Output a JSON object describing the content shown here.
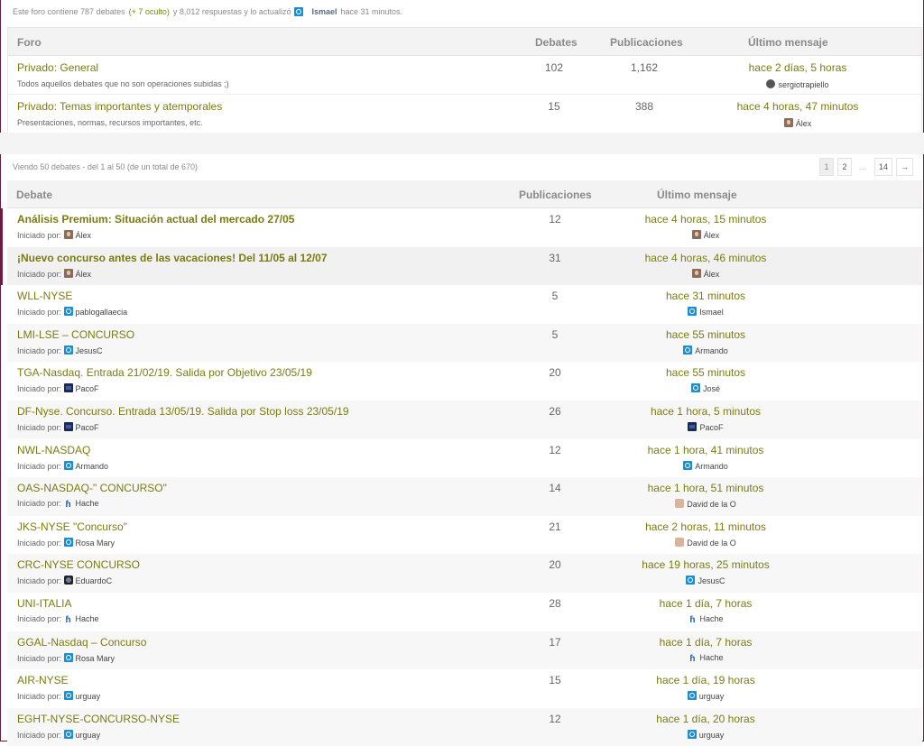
{
  "forum_info": {
    "prefix": "Este foro contiene 787 debates",
    "hidden": "(+ 7 oculto)",
    "middle": "y 8,012 respuestas y lo actualizó",
    "user": "Ismael",
    "time": "hace 31 minutos."
  },
  "forums_table": {
    "headers": {
      "forum": "Foro",
      "topics": "Debates",
      "posts": "Publicaciones",
      "last": "Último mensaje"
    },
    "rows": [
      {
        "title": "Privado: General",
        "desc": "Todos aquellos debates que no son operaciones subidas ;)",
        "topics": "102",
        "posts": "1,162",
        "last": "hace 2 días, 5 horas",
        "last_user": "sergiotrapiello",
        "icon": "avatar-round-icon"
      },
      {
        "title": "Privado: Temas importantes y atemporales",
        "desc": "Presentaciones, normas, recursos importantes, etc.",
        "topics": "15",
        "posts": "388",
        "last": "hace 4 horas, 47 minutos",
        "last_user": "Álex",
        "icon": "avatar-photo-icon"
      }
    ]
  },
  "viewing": "Viendo 50 debates - del 1 al 50 (de un total de 670)",
  "pagination": {
    "current": "1",
    "p2": "2",
    "dots": "…",
    "last": "14",
    "next": "→"
  },
  "topics_table": {
    "headers": {
      "topic": "Debate",
      "posts": "Publicaciones",
      "last": "Último mensaje"
    },
    "started_label": "Iniciado por:",
    "rows": [
      {
        "title": "Análisis Premium: Situación actual del mercado 27/05",
        "author": "Álex",
        "author_icon": "photo",
        "posts": "12",
        "last": "hace 4 horas, 15 minutos",
        "last_user": "Álex",
        "last_icon": "photo",
        "sticky": true
      },
      {
        "title": "¡Nuevo concurso antes de las vacaciones! Del 11/05 al 12/07",
        "author": "Álex",
        "author_icon": "photo",
        "posts": "31",
        "last": "hace 4 horas, 46 minutos",
        "last_user": "Álex",
        "last_icon": "photo",
        "sticky": true
      },
      {
        "title": "WLL-NYSE",
        "author": "pablogallaecia",
        "author_icon": "power",
        "posts": "5",
        "last": "hace 31 minutos",
        "last_user": "Ismael",
        "last_icon": "power"
      },
      {
        "title": "LMI-LSE – CONCURSO",
        "author": "JesusC",
        "author_icon": "power",
        "posts": "5",
        "last": "hace 55 minutos",
        "last_user": "Armando",
        "last_icon": "power"
      },
      {
        "title": "TGA-Nasdaq. Entrada 21/02/19. Salida por Objetivo 23/05/19",
        "author": "PacoF",
        "author_icon": "dark",
        "posts": "20",
        "last": "hace 55 minutos",
        "last_user": "José",
        "last_icon": "power"
      },
      {
        "title": "DF-Nyse. Concurso. Entrada 13/05/19. Salida por Stop loss 23/05/19",
        "author": "PacoF",
        "author_icon": "dark",
        "posts": "26",
        "last": "hace 1 hora, 5 minutos",
        "last_user": "PacoF",
        "last_icon": "dark"
      },
      {
        "title": "NWL-NASDAQ",
        "author": "Armando",
        "author_icon": "power",
        "posts": "12",
        "last": "hace 1 hora, 41 minutos",
        "last_user": "Armando",
        "last_icon": "power"
      },
      {
        "title": "OAS-NASDAQ-\" CONCURSO\"",
        "author": "Hache",
        "author_icon": "h",
        "posts": "14",
        "last": "hace 1 hora, 51 minutos",
        "last_user": "David de la O",
        "last_icon": "face"
      },
      {
        "title": "JKS-NYSE \"Concurso\"",
        "author": "Rosa Mary",
        "author_icon": "power",
        "posts": "21",
        "last": "hace 2 horas, 11 minutos",
        "last_user": "David de la O",
        "last_icon": "face"
      },
      {
        "title": "CRC-NYSE CONCURSO",
        "author": "EduardoC",
        "author_icon": "eye",
        "posts": "20",
        "last": "hace 19 horas, 25 minutos",
        "last_user": "JesusC",
        "last_icon": "power"
      },
      {
        "title": "UNI-ITALIA",
        "author": "Hache",
        "author_icon": "h",
        "posts": "28",
        "last": "hace 1 día, 7 horas",
        "last_user": "Hache",
        "last_icon": "h"
      },
      {
        "title": "GGAL-Nasdaq – Concurso",
        "author": "Rosa Mary",
        "author_icon": "power",
        "posts": "17",
        "last": "hace 1 día, 7 horas",
        "last_user": "Hache",
        "last_icon": "h"
      },
      {
        "title": "AIR-NYSE",
        "author": "urguay",
        "author_icon": "power",
        "posts": "15",
        "last": "hace 1 día, 19 horas",
        "last_user": "urguay",
        "last_icon": "power"
      },
      {
        "title": "EGHT-NYSE-CONCURSO-NYSE",
        "author": "urguay",
        "author_icon": "power",
        "posts": "12",
        "last": "hace 1 día, 20 horas",
        "last_user": "urguay",
        "last_icon": "power"
      }
    ]
  },
  "colors": {
    "link": "#7b7b14",
    "sticky_accent": "#6b1d3e",
    "header_bg": "#f3f3f3"
  }
}
